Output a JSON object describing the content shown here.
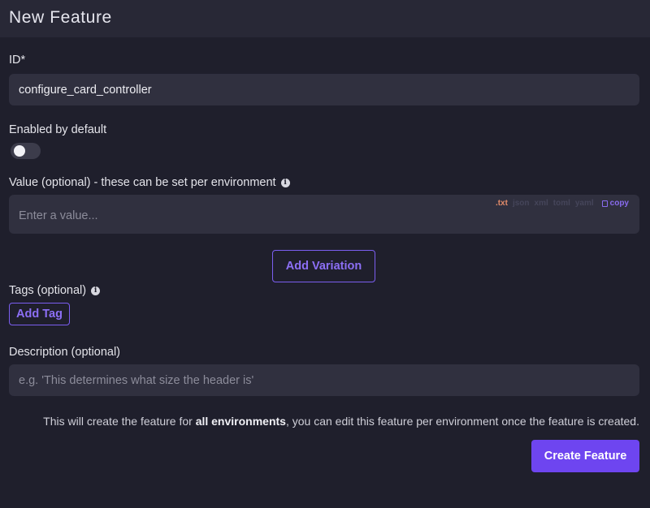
{
  "header": {
    "title": "New Feature"
  },
  "id_field": {
    "label": "ID*",
    "value": "configure_card_controller"
  },
  "enabled": {
    "label": "Enabled by default",
    "on": false
  },
  "value_field": {
    "label": "Value (optional) - these can be set per environment",
    "placeholder": "Enter a value...",
    "formats": [
      ".txt",
      "json",
      "xml",
      "toml",
      "yaml"
    ],
    "active_format": ".txt",
    "copy_label": "copy"
  },
  "add_variation_label": "Add Variation",
  "tags": {
    "label": "Tags (optional)",
    "add_label": "Add Tag"
  },
  "description": {
    "label": "Description (optional)",
    "placeholder": "e.g. 'This determines what size the header is'"
  },
  "notice": {
    "before": "This will create the feature for ",
    "bold": "all environments",
    "after": ", you can edit this feature per environment once the feature is created."
  },
  "create_label": "Create Feature",
  "colors": {
    "accent": "#6e45f0",
    "background": "#1f1f2c",
    "field": "#30303f"
  }
}
